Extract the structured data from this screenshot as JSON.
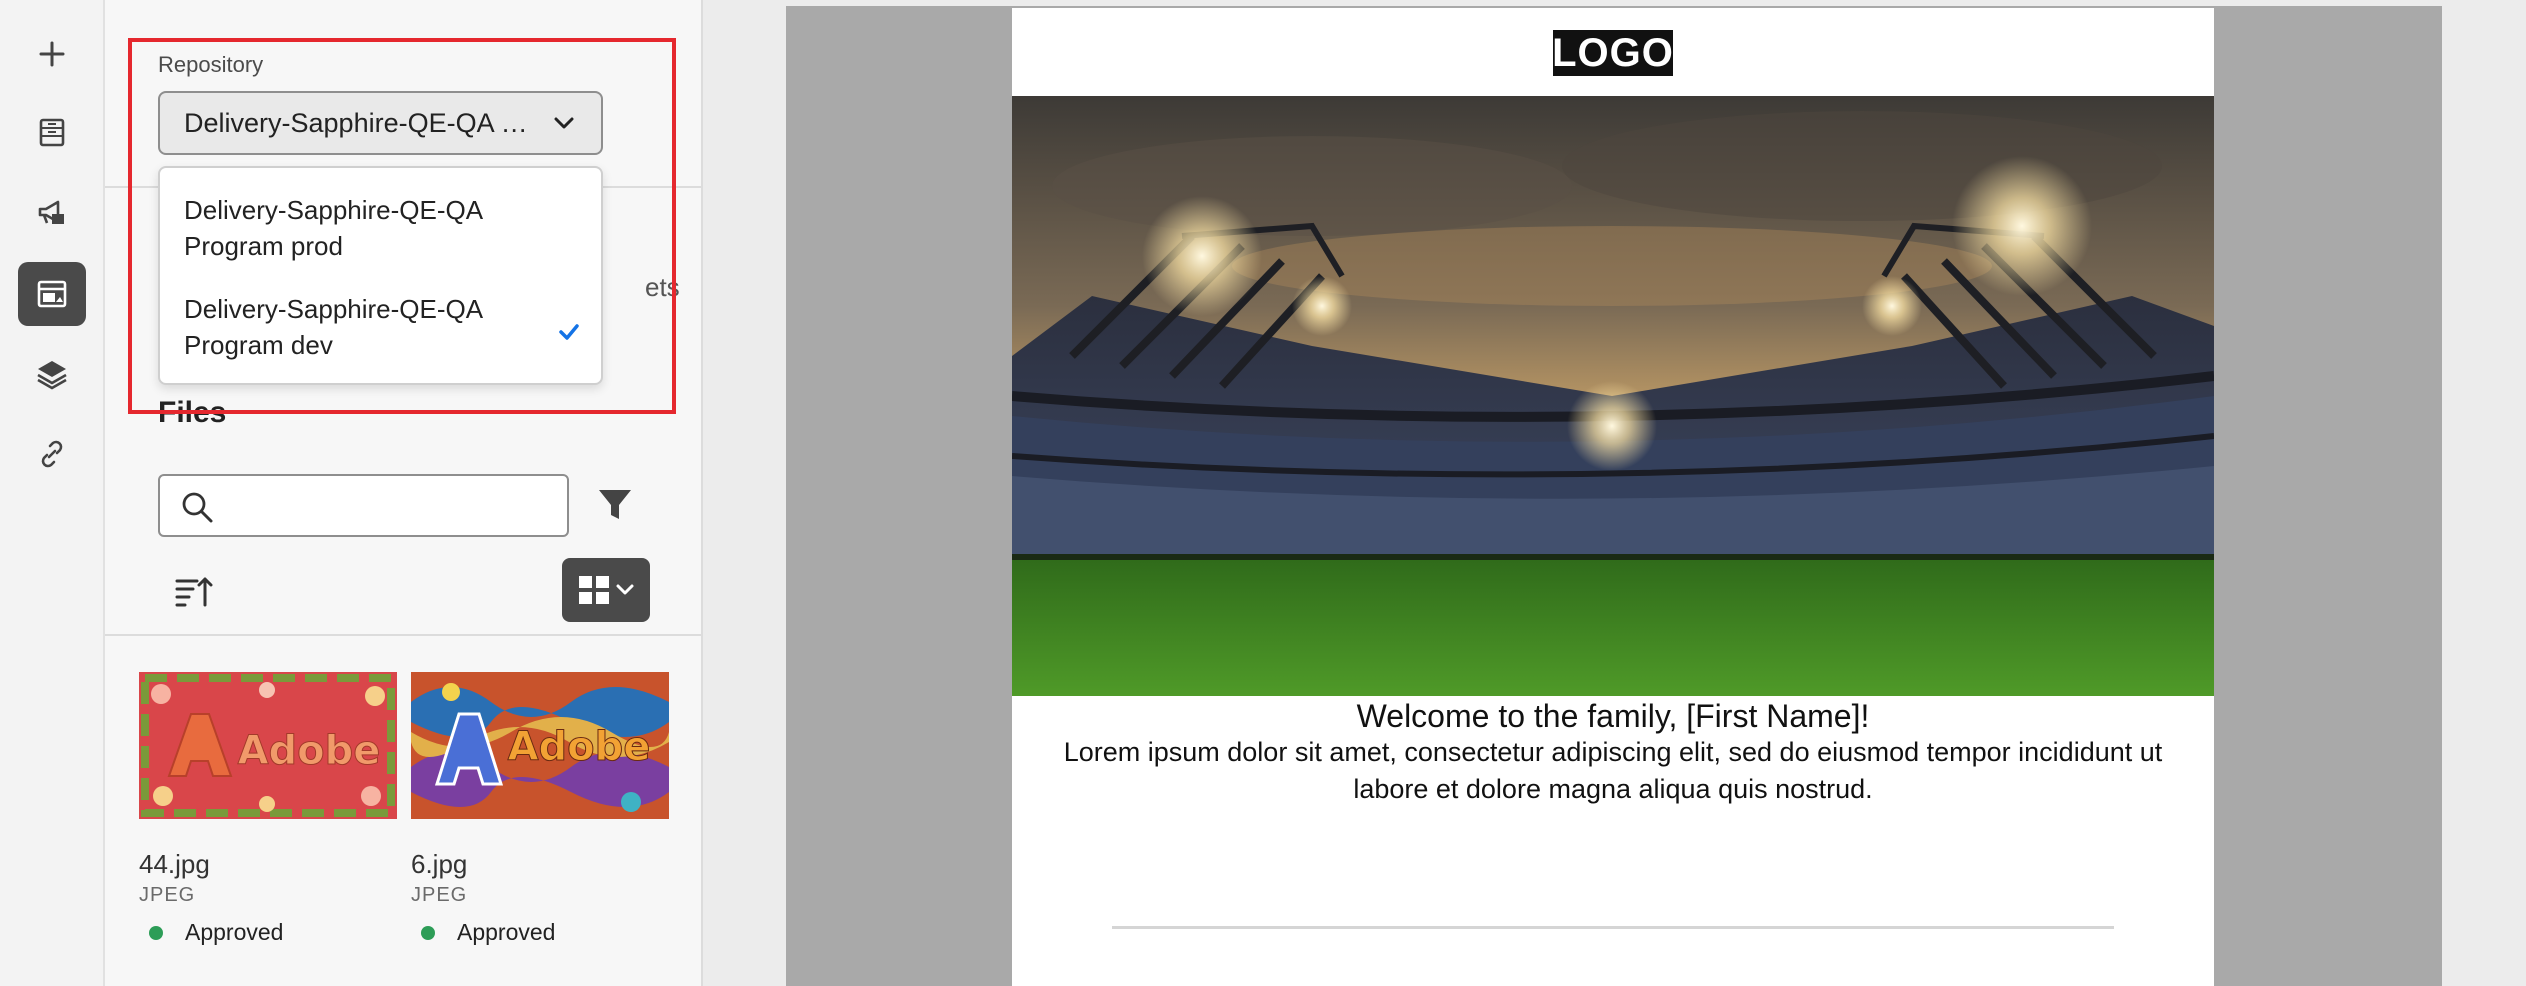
{
  "rail": {
    "items": [
      {
        "name": "add-icon"
      },
      {
        "name": "fragments-icon"
      },
      {
        "name": "campaign-icon"
      },
      {
        "name": "assets-icon",
        "active": true
      },
      {
        "name": "layers-icon"
      },
      {
        "name": "link-icon"
      }
    ]
  },
  "repository": {
    "label": "Repository",
    "selected_display": "Delivery-Sapphire-QE-QA Progra...",
    "options": [
      {
        "line1": "Delivery-Sapphire-QE-QA",
        "line2": "Program prod",
        "checked": false
      },
      {
        "line1": "Delivery-Sapphire-QE-QA",
        "line2": "Program dev",
        "checked": true
      }
    ]
  },
  "partial_tab_text": "ets",
  "files": {
    "title": "Files",
    "search_placeholder": "",
    "items": [
      {
        "name": "44.jpg",
        "type": "JPEG",
        "status": "Approved",
        "thumb_text": "Adobe"
      },
      {
        "name": "6.jpg",
        "type": "JPEG",
        "status": "Approved",
        "thumb_text": "Adobe"
      }
    ]
  },
  "email": {
    "logo": "LOGO",
    "headline": "Welcome to the family, [First Name]!",
    "body": "Lorem ipsum dolor sit amet, consectetur adipiscing elit, sed do eiusmod tempor incididunt ut labore et dolore magna aliqua quis nostrud."
  },
  "colors": {
    "highlight": "#e5282e",
    "approved": "#2d9d57",
    "active_rail": "#4a4a4a",
    "check": "#1473e6"
  }
}
